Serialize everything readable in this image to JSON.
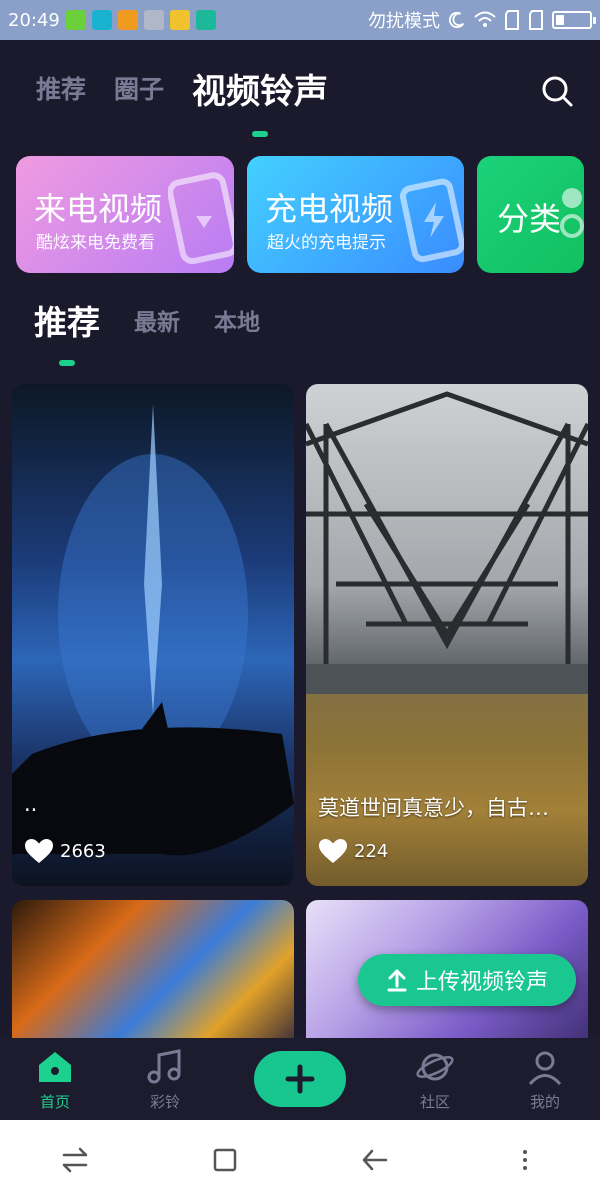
{
  "status_bar": {
    "time": "20:49",
    "dnd_text": "勿扰模式"
  },
  "top_tabs": [
    {
      "label": "推荐",
      "active": false
    },
    {
      "label": "圈子",
      "active": false
    },
    {
      "label": "视频铃声",
      "active": true
    }
  ],
  "banners": [
    {
      "title": "来电视频",
      "subtitle": "酷炫来电免费看"
    },
    {
      "title": "充电视频",
      "subtitle": "超火的充电提示"
    },
    {
      "title": "分类"
    }
  ],
  "sub_tabs": [
    {
      "label": "推荐",
      "active": true
    },
    {
      "label": "最新",
      "active": false
    },
    {
      "label": "本地",
      "active": false
    }
  ],
  "videos": [
    {
      "caption": "..",
      "likes": "2663"
    },
    {
      "caption": "莫道世间真意少，自古…",
      "likes": "224"
    },
    {
      "caption": "",
      "likes": ""
    },
    {
      "caption": "",
      "likes": ""
    }
  ],
  "upload_button": {
    "label": "上传视频铃声"
  },
  "bottom_nav": [
    {
      "label": "首页",
      "icon": "home-icon",
      "active": true
    },
    {
      "label": "彩铃",
      "icon": "music-note-icon",
      "active": false
    },
    {
      "label": "",
      "icon": "plus-icon",
      "active": false
    },
    {
      "label": "社区",
      "icon": "planet-icon",
      "active": false
    },
    {
      "label": "我的",
      "icon": "user-icon",
      "active": false
    }
  ],
  "colors": {
    "background": "#1b1a2c",
    "accent": "#1cd08d",
    "inactive_text": "#7b7a95"
  }
}
